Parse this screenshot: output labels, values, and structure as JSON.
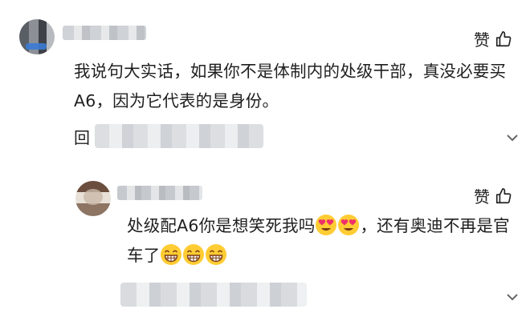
{
  "comments": [
    {
      "like_label": "赞",
      "text": "我说句大实话，如果你不是体制内的处级干部，真没必要买A6，因为它代表的是身份。",
      "reply_prefix": "回"
    },
    {
      "like_label": "赞",
      "text_part1": "处级配A6你是想笑死我吗",
      "text_part2": "，还有奥迪不再是官车了"
    }
  ],
  "icons": {
    "like": "thumbs-up-icon",
    "more": "chevron-down-icon",
    "emoji_heart_eyes": "heart-eyes-emoji-icon",
    "emoji_grin": "grinning-emoji-icon"
  },
  "colors": {
    "emoji_face": "#ffcc33",
    "emoji_heart": "#f0306a",
    "text": "#1f1f1f"
  }
}
